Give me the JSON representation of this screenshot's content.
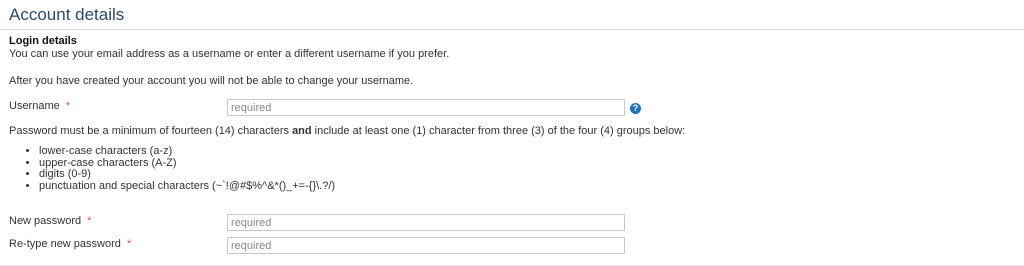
{
  "header": {
    "title": "Account details"
  },
  "login": {
    "heading": "Login details",
    "intro": "You can use your email address as a username or enter a different username if you prefer.",
    "note": "After you have created your account you will not be able to change your username."
  },
  "username": {
    "label": "Username",
    "required_mark": "*",
    "placeholder": "required",
    "help_icon": "question-circle-icon"
  },
  "password_rules": {
    "intro_before": "Password must be a minimum of fourteen (14) characters ",
    "intro_bold": "and",
    "intro_after": " include at least one (1) character from three (3) of the four (4) groups below:",
    "items": [
      "lower-case characters (a-z)",
      "upper-case characters (A-Z)",
      "digits (0-9)",
      "punctuation and special characters (~`!@#$%^&*()_+=-{}\\.?/)"
    ]
  },
  "new_password": {
    "label": "New password",
    "required_mark": "*",
    "placeholder": "required"
  },
  "retype_password": {
    "label": "Re-type new password",
    "required_mark": "*",
    "placeholder": "required"
  },
  "colors": {
    "title": "#2b4a6b",
    "required": "#d9534f",
    "help_icon": "#1f6fc4"
  }
}
